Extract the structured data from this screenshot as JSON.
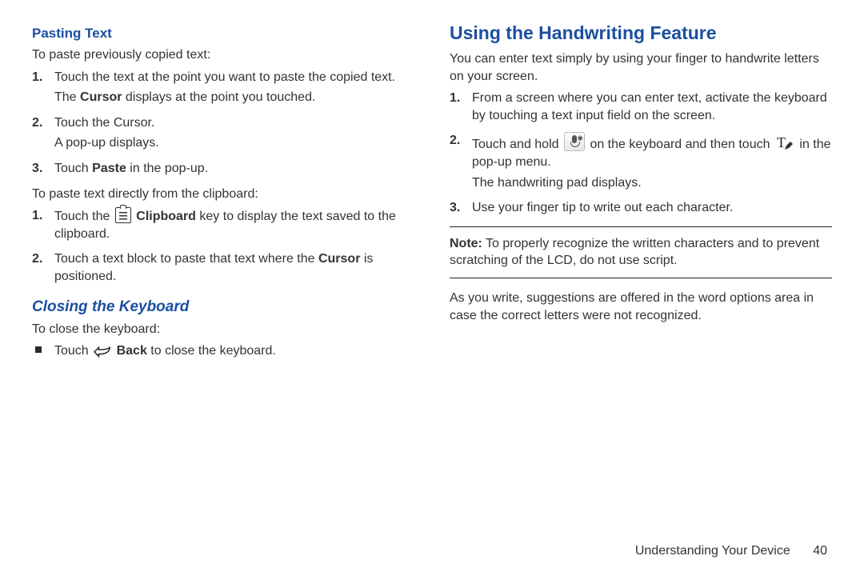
{
  "left": {
    "pasting_heading": "Pasting Text",
    "paste_intro": "To paste previously copied text:",
    "paste_steps": [
      {
        "n": "1.",
        "text": "Touch the text at the point you want to paste the copied text.",
        "sub_pre": "The ",
        "sub_bold": "Cursor",
        "sub_post": " displays at the point you touched."
      },
      {
        "n": "2.",
        "text": "Touch the Cursor.",
        "sub": "A pop-up displays."
      },
      {
        "n": "3.",
        "pre": "Touch ",
        "bold": "Paste",
        "post": " in the pop-up."
      }
    ],
    "clipboard_intro": "To paste text directly from the clipboard:",
    "clipboard_steps": [
      {
        "n": "1.",
        "pre": "Touch the ",
        "icon": "clipboard",
        "bold": " Clipboard",
        "post": " key to display the text saved to the clipboard."
      },
      {
        "n": "2.",
        "pre": "Touch a text block to paste that text where the ",
        "bold": "Cursor",
        "post": " is positioned."
      }
    ],
    "closing_heading": "Closing the Keyboard",
    "closing_intro": "To close the keyboard:",
    "closing_bullet_pre": "Touch ",
    "closing_bullet_bold": " Back",
    "closing_bullet_post": " to close the keyboard."
  },
  "right": {
    "heading": "Using the Handwriting Feature",
    "intro": "You can enter text simply by using your finger to handwrite letters on your screen.",
    "steps": [
      {
        "n": "1.",
        "text": "From a screen where you can enter text, activate the keyboard by touching a text input field on the screen."
      },
      {
        "n": "2.",
        "pre": "Touch and hold ",
        "icon1": "mic",
        "mid": " on the keyboard and then touch ",
        "icon2": "tpen",
        "post": " in the pop-up menu.",
        "sub": "The handwriting pad displays."
      },
      {
        "n": "3.",
        "text": "Use your finger tip to write out each character."
      }
    ],
    "note_label": "Note:",
    "note_text": " To properly recognize the written characters and to prevent scratching of the LCD, do not use script.",
    "after_note": "As you write, suggestions are offered in the word options area in case the correct letters were not recognized."
  },
  "footer": {
    "section": "Understanding Your Device",
    "page": "40"
  }
}
